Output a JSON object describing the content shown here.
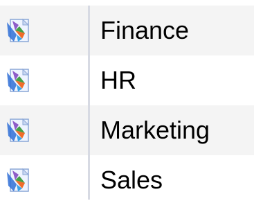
{
  "list": {
    "items": [
      {
        "label": "Finance",
        "icon": "database-report-icon"
      },
      {
        "label": "HR",
        "icon": "database-report-icon"
      },
      {
        "label": "Marketing",
        "icon": "database-report-icon"
      },
      {
        "label": "Sales",
        "icon": "database-report-icon"
      }
    ]
  },
  "colors": {
    "row_alt": "#f4f4f4",
    "row_plain": "#ffffff",
    "divider": "#d7dae3"
  }
}
